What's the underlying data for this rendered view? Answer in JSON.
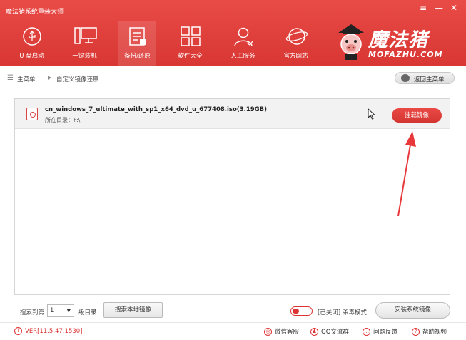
{
  "window": {
    "title": "魔法猪系统重装大师",
    "controls": [
      "≡",
      "—",
      "✕"
    ]
  },
  "nav": [
    {
      "label": "U 盘启动",
      "icon": "usb-icon",
      "active": false
    },
    {
      "label": "一键装机",
      "icon": "computer-icon",
      "active": false
    },
    {
      "label": "备份/还原",
      "icon": "backup-icon",
      "active": true
    },
    {
      "label": "软件大全",
      "icon": "apps-grid-icon",
      "active": false
    },
    {
      "label": "人工服务",
      "icon": "person-icon",
      "active": false
    },
    {
      "label": "官方网站",
      "icon": "globe-icon",
      "active": false
    }
  ],
  "logo": {
    "cn": "魔法猪",
    "en": "MOFAZHU.COM"
  },
  "breadcrumb": {
    "home": "主菜单",
    "current": "自定义镜像还原"
  },
  "back_button": "返回主菜单",
  "file": {
    "name": "cn_windows_7_ultimate_with_sp1_x64_dvd_u_677408.iso(3.19GB)",
    "dir": "所在目录：F:\\"
  },
  "mount_button": "挂载镜像",
  "bottom": {
    "search_prefix": "搜索到第",
    "level_value": "1",
    "level_suffix": "级目录",
    "search_local_button": "搜索本地镜像",
    "toggle_state": "[已关闭]",
    "toggle_label": "杀毒模式",
    "install_button": "安装系统镜像"
  },
  "footer": {
    "version": "VER[11.5.47.1530]",
    "wechat": "微信客服",
    "qq": "QQ交流群",
    "feedback": "问题反馈",
    "help": "帮助视频"
  },
  "colors": {
    "accent": "#e0403c"
  }
}
